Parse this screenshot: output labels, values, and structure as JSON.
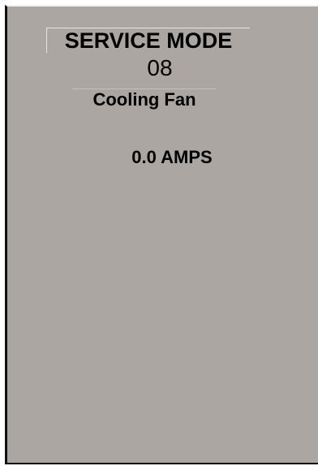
{
  "screen": {
    "title": "SERVICE MODE",
    "mode_number": "08",
    "mode_name": "Cooling Fan",
    "reading": "0.0 AMPS"
  },
  "colors": {
    "screen_background": "#aba6a2",
    "text": "#000000",
    "frame_edge": "#111111"
  }
}
